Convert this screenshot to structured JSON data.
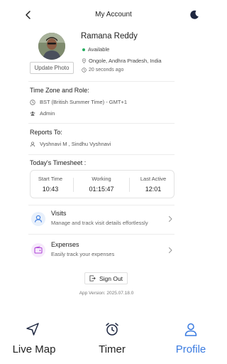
{
  "header": {
    "title": "My Account",
    "back_icon": "chevron-left-icon",
    "theme_icon": "moon-icon"
  },
  "profile": {
    "name": "Ramana Reddy",
    "status": "Available",
    "status_color": "#27ae60",
    "location": "Ongole, Andhra Pradesh, India",
    "last_seen": "20 seconds ago",
    "update_photo_label": "Update Photo"
  },
  "timezone": {
    "title": "Time Zone and Role:",
    "timezone_value": "BST (British Summer Time) - GMT+1",
    "role": "Admin"
  },
  "reports": {
    "title": "Reports To:",
    "value": "Vyshnavi M , Sindhu Vyshnavi"
  },
  "timesheet": {
    "title": "Today's Timesheet :",
    "items": [
      {
        "label": "Start Time",
        "value": "10:43"
      },
      {
        "label": "Working",
        "value": "01:15:47"
      },
      {
        "label": "Last Active",
        "value": "12:01"
      }
    ]
  },
  "menu": [
    {
      "title": "Visits",
      "subtitle": "Manage and track visit details effortlessly",
      "icon": "user-icon",
      "icon_bg": "#e8f0fb",
      "icon_color": "#3a7be0"
    },
    {
      "title": "Expenses",
      "subtitle": "Easily track your expenses",
      "icon": "wallet-icon",
      "icon_bg": "#f6eafb",
      "icon_color": "#b046d8"
    }
  ],
  "signout_label": "Sign Out",
  "app_version": "App Version: 2025.07.18.0",
  "bottom_nav": [
    {
      "label": "Live Map",
      "icon": "navigation-icon",
      "active": false
    },
    {
      "label": "Timer",
      "icon": "alarm-clock-icon",
      "active": false
    },
    {
      "label": "Profile",
      "icon": "user-icon",
      "active": true
    }
  ],
  "colors": {
    "accent": "#3a7be0",
    "available": "#27ae60"
  }
}
